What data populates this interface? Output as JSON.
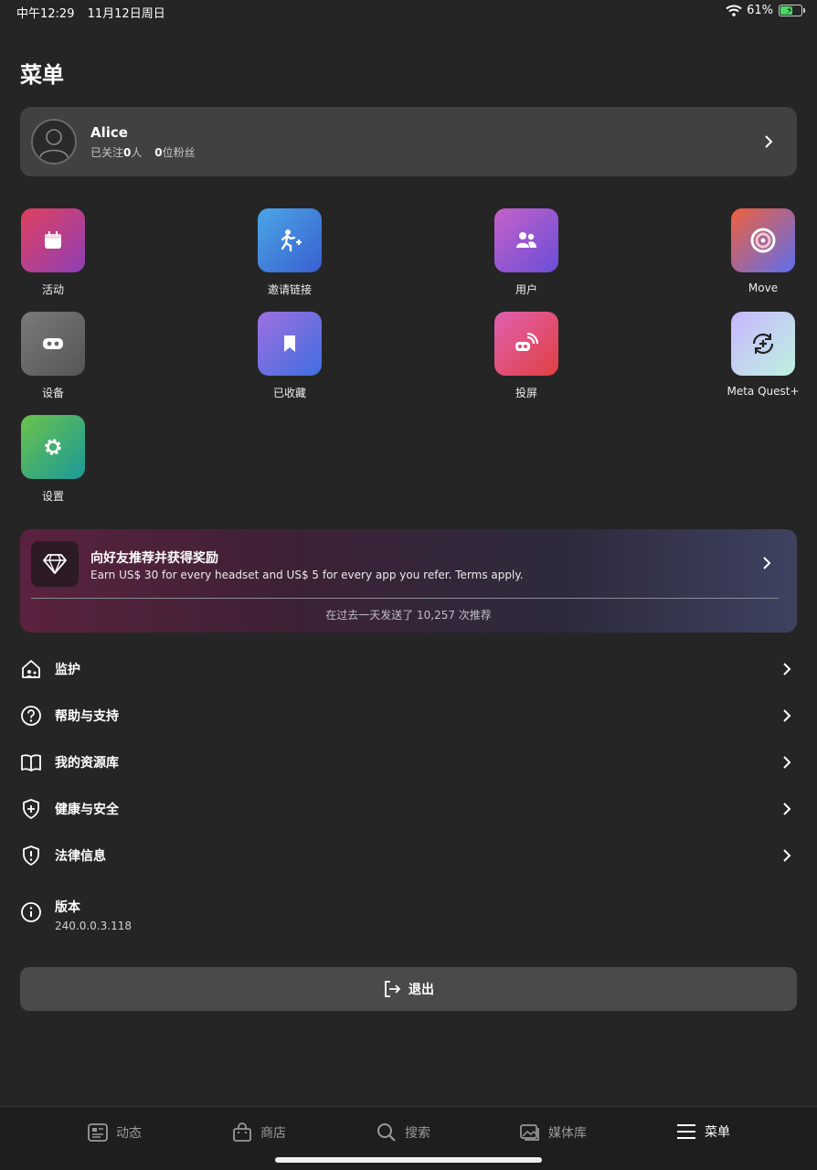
{
  "status_bar": {
    "time": "中午12:29",
    "date": "11月12日周日",
    "battery_percent": "61%",
    "battery_level": 0.61
  },
  "page": {
    "title": "菜单"
  },
  "profile": {
    "name": "Alice",
    "following_prefix": "已关注",
    "following_count": "0",
    "following_suffix": "人",
    "followers_count": "0",
    "followers_suffix": "位粉丝"
  },
  "apps": [
    {
      "label": "活动",
      "icon": "calendar-icon",
      "colors": [
        "#e0405e",
        "#8e3fb8"
      ]
    },
    {
      "label": "邀请链接",
      "icon": "person-add-icon",
      "colors": [
        "#4aa6e6",
        "#3a5fd0"
      ]
    },
    {
      "label": "用户",
      "icon": "people-icon",
      "colors": [
        "#c562c8",
        "#6a4ed8"
      ]
    },
    {
      "label": "Move",
      "icon": "move-ring-icon",
      "colors": [
        "#f0603a",
        "#5d6ef0"
      ]
    },
    {
      "label": "设备",
      "icon": "headset-icon",
      "colors": [
        "#7a7a7a",
        "#555555"
      ]
    },
    {
      "label": "已收藏",
      "icon": "bookmark-icon",
      "colors": [
        "#9f6fe0",
        "#3f6fe0"
      ]
    },
    {
      "label": "投屏",
      "icon": "cast-icon",
      "colors": [
        "#e060b0",
        "#e04040"
      ]
    },
    {
      "label": "Meta Quest+",
      "icon": "quest-plus-icon",
      "colors": [
        "#c7b6ff",
        "#bff2e0"
      ]
    },
    {
      "label": "设置",
      "icon": "gear-icon",
      "colors": [
        "#6cc24a",
        "#1a9a9a"
      ]
    }
  ],
  "referral": {
    "title": "向好友推荐并获得奖励",
    "description": "Earn US$ 30 for every headset and US$ 5 for every app you refer. Terms apply.",
    "count_text": "在过去一天发送了 10,257 次推荐"
  },
  "menu": [
    {
      "label": "监护",
      "icon": "parental-supervision-icon"
    },
    {
      "label": "帮助与支持",
      "icon": "help-icon"
    },
    {
      "label": "我的资源库",
      "icon": "book-icon"
    },
    {
      "label": "健康与安全",
      "icon": "shield-plus-icon"
    },
    {
      "label": "法律信息",
      "icon": "shield-alert-icon"
    }
  ],
  "version": {
    "label": "版本",
    "number": "240.0.0.3.118",
    "icon": "info-icon"
  },
  "logout": {
    "label": "退出",
    "icon": "logout-icon"
  },
  "nav": [
    {
      "label": "动态",
      "icon": "feed-icon",
      "active": false
    },
    {
      "label": "商店",
      "icon": "store-icon",
      "active": false
    },
    {
      "label": "搜索",
      "icon": "search-icon",
      "active": false
    },
    {
      "label": "媒体库",
      "icon": "media-library-icon",
      "active": false
    },
    {
      "label": "菜单",
      "icon": "menu-icon",
      "active": true
    }
  ]
}
